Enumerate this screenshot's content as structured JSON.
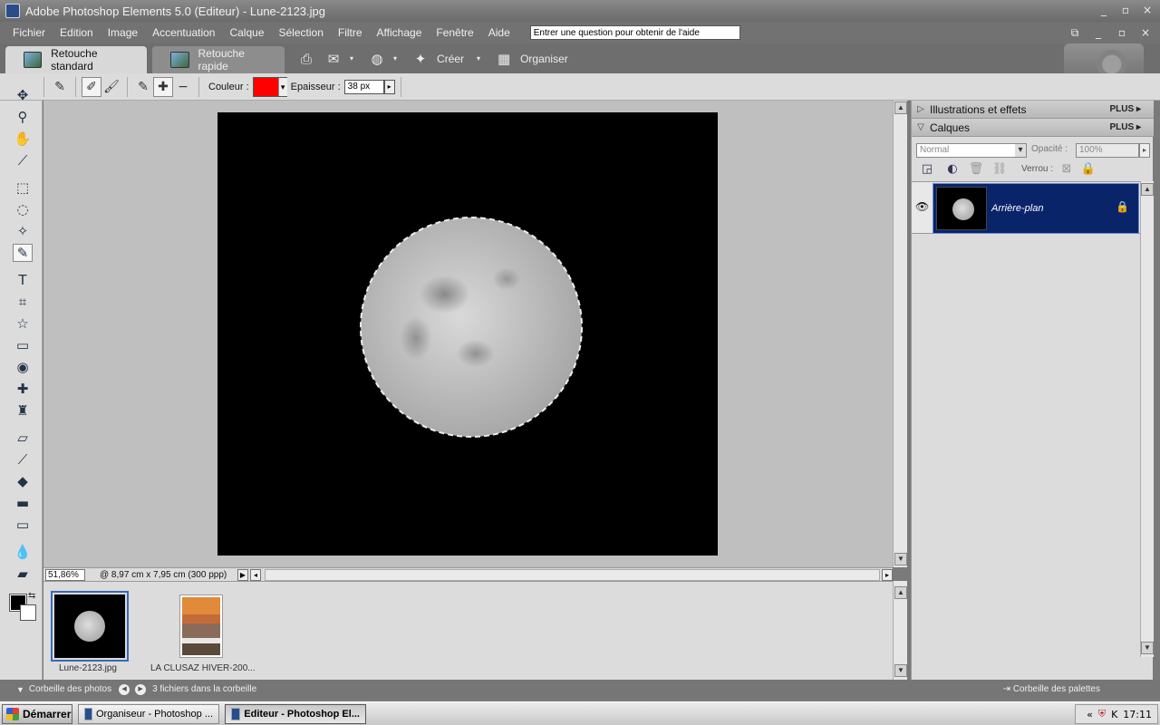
{
  "window": {
    "title": "Adobe Photoshop Elements 5.0 (Editeur) - Lune-2123.jpg",
    "controls": {
      "minimize": "_",
      "maximize": "▫",
      "close": "×"
    }
  },
  "menu": {
    "items": [
      "Fichier",
      "Edition",
      "Image",
      "Accentuation",
      "Calque",
      "Sélection",
      "Filtre",
      "Affichage",
      "Fenêtre",
      "Aide"
    ],
    "help_placeholder": "Entrer une question pour obtenir de l'aide"
  },
  "modebar": {
    "tabs": [
      {
        "label": "Retouche standard",
        "active": true
      },
      {
        "label": "Retouche rapide",
        "active": false
      }
    ],
    "create_label": "Créer",
    "organize_label": "Organiser"
  },
  "options": {
    "color_label": "Couleur :",
    "color_value": "#ff0000",
    "size_label": "Epaisseur :",
    "size_value": "38 px"
  },
  "document": {
    "zoom": "51,86%",
    "info": "@ 8,97 cm x 7,95 cm (300 ppp)"
  },
  "photobin": {
    "items": [
      {
        "label": "Lune-2123.jpg",
        "selected": true
      },
      {
        "label": "LA CLUSAZ HIVER-200...",
        "selected": false
      }
    ],
    "bin_label": "Corbeille des photos",
    "count_label": "3 fichiers dans la corbeille"
  },
  "panels": {
    "effects_title": "Illustrations et effets",
    "layers_title": "Calques",
    "plus_label": "PLUS",
    "blend_mode": "Normal",
    "opacity_label": "Opacité :",
    "opacity_value": "100%",
    "lock_label": "Verrou :",
    "layer_name": "Arrière-plan",
    "palette_bin_label": "Corbeille des palettes"
  },
  "taskbar": {
    "start_label": "Démarrer",
    "tasks": [
      {
        "label": "Organiseur - Photoshop ...",
        "active": false
      },
      {
        "label": "Editeur - Photoshop El...",
        "active": true
      }
    ],
    "clock": "17:11"
  }
}
